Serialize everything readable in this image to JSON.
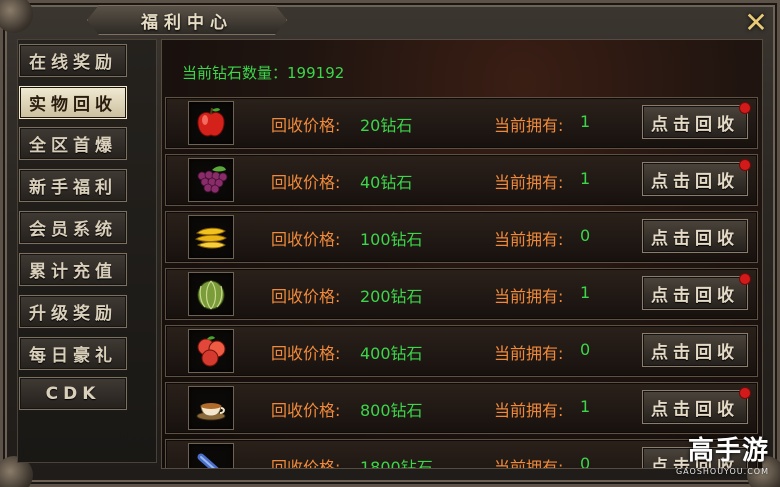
{
  "window": {
    "title": "福利中心",
    "close_symbol": "✕"
  },
  "sidebar": {
    "tabs": [
      {
        "label": "在线奖励",
        "active": false
      },
      {
        "label": "实物回收",
        "active": true
      },
      {
        "label": "全区首爆",
        "active": false
      },
      {
        "label": "新手福利",
        "active": false
      },
      {
        "label": "会员系统",
        "active": false
      },
      {
        "label": "累计充值",
        "active": false
      },
      {
        "label": "升级奖励",
        "active": false
      },
      {
        "label": "每日豪礼",
        "active": false
      },
      {
        "label": "CDK",
        "active": false
      }
    ]
  },
  "main": {
    "diamond_count_label": "当前钻石数量：",
    "diamond_count": "199192",
    "price_label": "回收价格:",
    "own_label": "当前拥有:",
    "button_label": "点击回收",
    "items": [
      {
        "icon": "apple-icon",
        "price": "20钻石",
        "owned": "1",
        "notify": true
      },
      {
        "icon": "grapes-icon",
        "price": "40钻石",
        "owned": "1",
        "notify": true
      },
      {
        "icon": "banana-icon",
        "price": "100钻石",
        "owned": "0",
        "notify": false
      },
      {
        "icon": "melon-icon",
        "price": "200钻石",
        "owned": "1",
        "notify": true
      },
      {
        "icon": "peaches-icon",
        "price": "400钻石",
        "owned": "0",
        "notify": false
      },
      {
        "icon": "tea-cup-icon",
        "price": "800钻石",
        "owned": "1",
        "notify": true
      },
      {
        "icon": "scroll-item-icon",
        "price": "1800钻石",
        "owned": "0",
        "notify": false
      }
    ]
  },
  "watermark": {
    "brand": "高手游",
    "domain": "GAOSHOUYOU.COM"
  },
  "colors": {
    "green_text": "#3cd64a",
    "orange_text": "#f08a3a",
    "red_dot": "#d31a1a"
  }
}
